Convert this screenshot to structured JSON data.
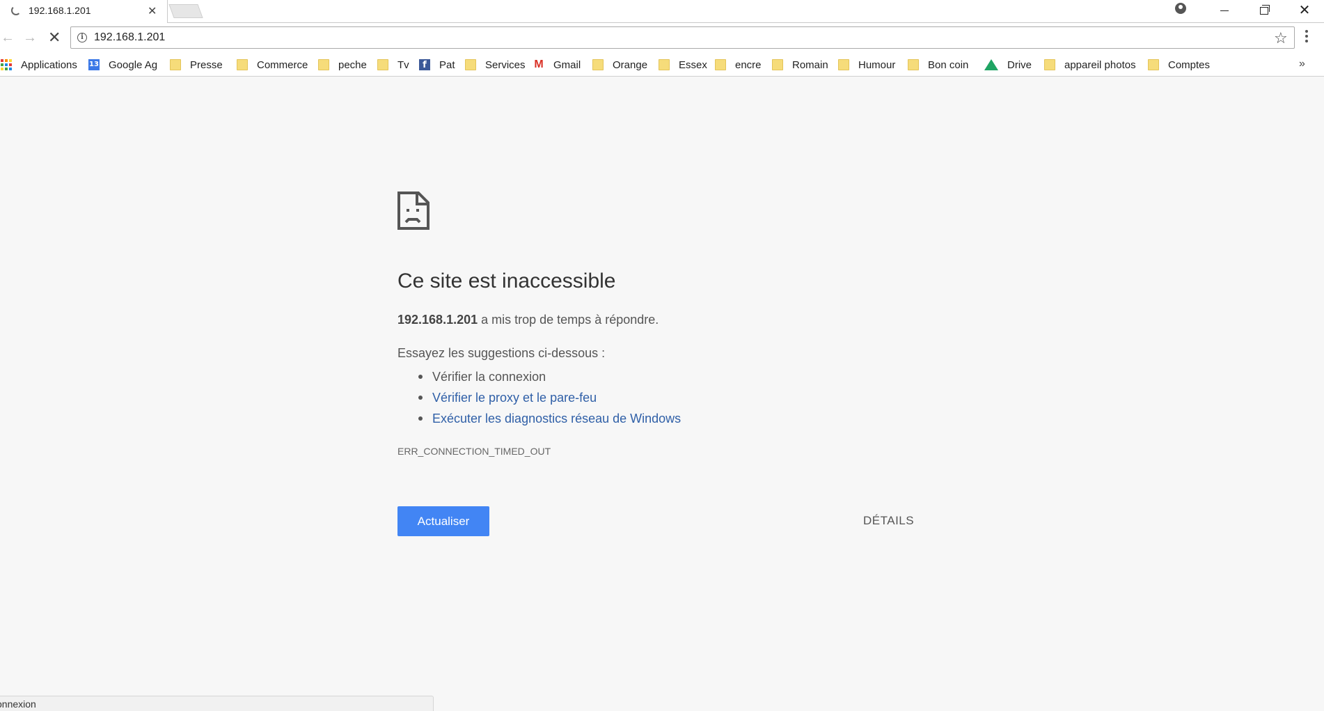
{
  "tab": {
    "title": "192.168.1.201",
    "close_glyph": "✕"
  },
  "toolbar": {
    "back_glyph": "←",
    "forward_glyph": "→",
    "stop_glyph": "✕",
    "url": "192.168.1.201",
    "info_glyph": "i",
    "star_glyph": "☆"
  },
  "window_controls": {
    "close_glyph": "✕"
  },
  "bookmarks": {
    "items": [
      {
        "label": "Applications",
        "icon": "apps-icon"
      },
      {
        "label": "Google Ag",
        "icon": "calendar-icon",
        "icon_text": "13"
      },
      {
        "label": "Presse",
        "icon": "folder-icon"
      },
      {
        "label": "Commerce",
        "icon": "folder-icon"
      },
      {
        "label": "peche",
        "icon": "folder-icon"
      },
      {
        "label": "Tv",
        "icon": "folder-icon"
      },
      {
        "label": "Pat",
        "icon": "facebook-icon",
        "icon_text": "f"
      },
      {
        "label": "Services",
        "icon": "folder-icon"
      },
      {
        "label": "Gmail",
        "icon": "gmail-icon",
        "icon_text": "M"
      },
      {
        "label": "Orange",
        "icon": "folder-icon"
      },
      {
        "label": "Essex",
        "icon": "folder-icon"
      },
      {
        "label": "encre",
        "icon": "folder-icon"
      },
      {
        "label": "Romain",
        "icon": "folder-icon"
      },
      {
        "label": "Humour",
        "icon": "folder-icon"
      },
      {
        "label": "Bon coin",
        "icon": "folder-icon"
      },
      {
        "label": "Drive",
        "icon": "drive-icon"
      },
      {
        "label": "appareil photos",
        "icon": "folder-icon"
      },
      {
        "label": "Comptes",
        "icon": "folder-icon"
      }
    ],
    "more_glyph": "»"
  },
  "error": {
    "title": "Ce site est inaccessible",
    "host": "192.168.1.201",
    "description": " a mis trop de temps à répondre.",
    "suggest_intro": "Essayez les suggestions ci-dessous :",
    "suggestions": [
      "Vérifier la connexion",
      "Vérifier le proxy et le pare-feu",
      "Exécuter les diagnostics réseau de Windows"
    ],
    "code": "ERR_CONNECTION_TIMED_OUT",
    "reload_label": "Actualiser",
    "details_label": "DÉTAILS"
  },
  "status": {
    "text": "onnexion"
  },
  "colors": {
    "accent": "#4285f4",
    "link": "#2f5fa7",
    "folder": "#f6dc7a"
  }
}
